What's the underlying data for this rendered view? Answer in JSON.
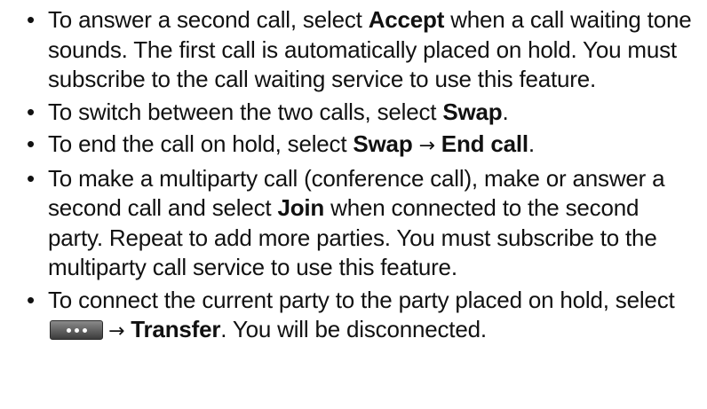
{
  "items": [
    {
      "pre": "To answer a second call, select ",
      "bold": "Accept",
      "post": " when a call waiting tone sounds. The first call is automatically placed on hold. You must subscribe to the call waiting service to use this feature."
    },
    {
      "pre": "To switch between the two calls, select ",
      "bold": "Swap",
      "post": "."
    },
    {
      "pre": "To end the call on hold, select ",
      "bold1": "Swap",
      "arrow": "→",
      "bold2": "End call",
      "post": "."
    },
    {
      "pre": "To make a multiparty call (conference call), make or answer a second call and select ",
      "bold": "Join",
      "post": " when connected to the second party. Repeat to add more parties. You must subscribe to the multiparty call service to use this feature."
    },
    {
      "pre": "To connect the current party to the party placed on hold, select ",
      "icon": "more-options-icon",
      "arrow": "→",
      "bold": "Transfer",
      "post": ". You will be disconnected."
    }
  ],
  "bullet_glyph": "•"
}
